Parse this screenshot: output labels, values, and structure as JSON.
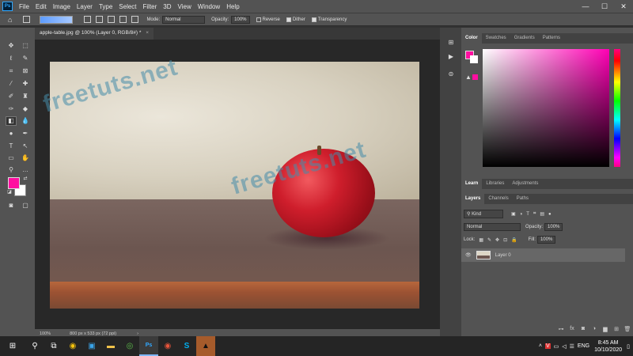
{
  "menubar": {
    "app_icon": "Ps",
    "items": [
      "File",
      "Edit",
      "Image",
      "Layer",
      "Type",
      "Select",
      "Filter",
      "3D",
      "View",
      "Window",
      "Help"
    ],
    "window_controls": [
      "—",
      "☐",
      "✕"
    ]
  },
  "options": {
    "mode_label": "Mode:",
    "mode_value": "Normal",
    "opacity_label": "Opacity:",
    "opacity_value": "100%",
    "reverse": "Reverse",
    "dither": "Dither",
    "transparency": "Transparency"
  },
  "document": {
    "tab_title": "apple-table.jpg @ 100% (Layer 0, RGB/8#) *",
    "zoom": "100%",
    "dimensions": "800 px x 533 px (72 ppi)"
  },
  "watermark": "freetuts.net",
  "colors": {
    "foreground": "#ff0ea0",
    "background": "#ffffff",
    "picker_hue": "#ff00b4"
  },
  "color_panel": {
    "tabs": [
      "Color",
      "Swatches",
      "Gradients",
      "Patterns"
    ]
  },
  "learn_panel": {
    "tabs": [
      "Learn",
      "Libraries",
      "Adjustments"
    ]
  },
  "layers_panel": {
    "tabs": [
      "Layers",
      "Channels",
      "Paths"
    ],
    "filter_value": "Kind",
    "blend_mode": "Normal",
    "opacity_label": "Opacity:",
    "opacity_value": "100%",
    "lock_label": "Lock:",
    "fill_label": "Fill:",
    "fill_value": "100%",
    "layers": [
      {
        "name": "Layer 0",
        "visible": true
      }
    ]
  },
  "taskbar": {
    "time": "8:45 AM",
    "date": "10/10/2020",
    "lang": "ENG"
  }
}
